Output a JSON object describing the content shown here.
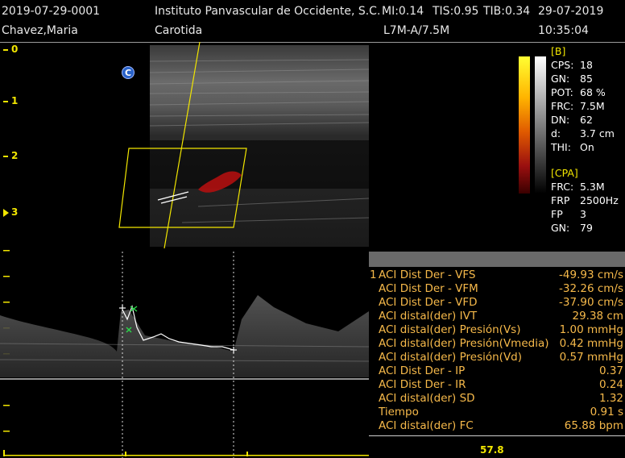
{
  "header": {
    "study_id": "2019-07-29-0001",
    "institution": "Instituto Panvascular de Occidente, S.C.",
    "mi": "MI:0.14",
    "tis": "TIS:0.95",
    "tib": "TIB:0.34",
    "date": "29-07-2019",
    "patient": "Chavez,Maria",
    "exam": "Carotida",
    "probe": "L7M-A/7.5M",
    "time": "10:35:04"
  },
  "depth_scale": [
    "0",
    "1",
    "2",
    "3"
  ],
  "annotation": "C",
  "bmode": {
    "title": "[B]",
    "params": [
      {
        "k": "CPS:",
        "v": "18"
      },
      {
        "k": "GN:",
        "v": "85"
      },
      {
        "k": "POT:",
        "v": "68 %"
      },
      {
        "k": "FRC:",
        "v": "7.5M"
      },
      {
        "k": "DN:",
        "v": "62"
      },
      {
        "k": "d:",
        "v": "3.7 cm"
      },
      {
        "k": "THI:",
        "v": "On"
      }
    ]
  },
  "cpa": {
    "title": "[CPA]",
    "params": [
      {
        "k": "FRC:",
        "v": "5.3M"
      },
      {
        "k": "FRP",
        "v": "2500Hz"
      },
      {
        "k": "FP",
        "v": "3"
      },
      {
        "k": "GN:",
        "v": "79"
      }
    ]
  },
  "measurements": {
    "index": "1",
    "rows": [
      {
        "label": "ACI Dist Der - VFS",
        "value": "-49.93 cm/s"
      },
      {
        "label": "ACI Dist Der - VFM",
        "value": "-32.26 cm/s"
      },
      {
        "label": "ACI Dist Der - VFD",
        "value": "-37.90 cm/s"
      },
      {
        "label": "ACI distal(der) IVT",
        "value": "29.38 cm"
      },
      {
        "label": "ACI distal(der) Presión(Vs)",
        "value": "1.00 mmHg"
      },
      {
        "label": "ACI distal(der) Presión(Vmedia)",
        "value": "0.42 mmHg"
      },
      {
        "label": "ACI distal(der) Presión(Vd)",
        "value": "0.57 mmHg"
      },
      {
        "label": "ACI Dist Der - IP",
        "value": "0.37"
      },
      {
        "label": "ACI Dist Der - IR",
        "value": "0.24"
      },
      {
        "label": "ACI distal(der) SD",
        "value": "1.32"
      },
      {
        "label": "Tiempo",
        "value": "0.91 s"
      },
      {
        "label": "ACI distal(der) FC",
        "value": "65.88 bpm"
      }
    ]
  },
  "bottom_value": "57.8",
  "colors": {
    "accent": "#f2e600",
    "measure_text": "#f6b94a",
    "doppler_flow": "#b01010"
  }
}
